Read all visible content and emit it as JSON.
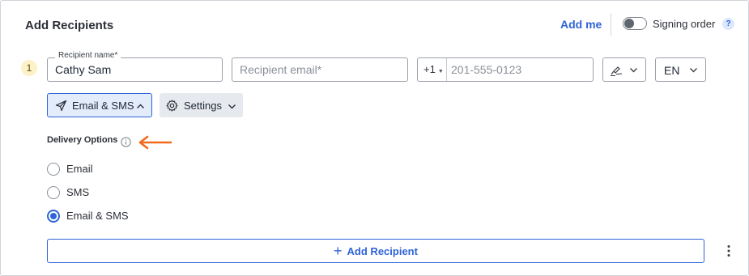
{
  "header": {
    "title": "Add Recipients",
    "add_me_label": "Add me",
    "signing_order_label": "Signing order",
    "signing_order_enabled": false,
    "help_label": "?"
  },
  "recipient": {
    "number": "1",
    "name_label": "Recipient name*",
    "name_value": "Cathy Sam",
    "email_placeholder": "Recipient email*",
    "email_value": "",
    "phone_code": "+1",
    "phone_placeholder": "201-555-0123",
    "signature_type_icon": "signature-icon",
    "language_value": "EN"
  },
  "actions": {
    "delivery_button_label": "Email & SMS",
    "settings_button_label": "Settings"
  },
  "delivery": {
    "title": "Delivery Options",
    "options": [
      {
        "label": "Email",
        "selected": false
      },
      {
        "label": "SMS",
        "selected": false
      },
      {
        "label": "Email & SMS",
        "selected": true
      }
    ]
  },
  "footer": {
    "add_recipient_label": "Add Recipient"
  },
  "colors": {
    "accent": "#2f63d6",
    "annotation_arrow": "#f26b1d",
    "badge_bg": "#fcf1c7"
  }
}
